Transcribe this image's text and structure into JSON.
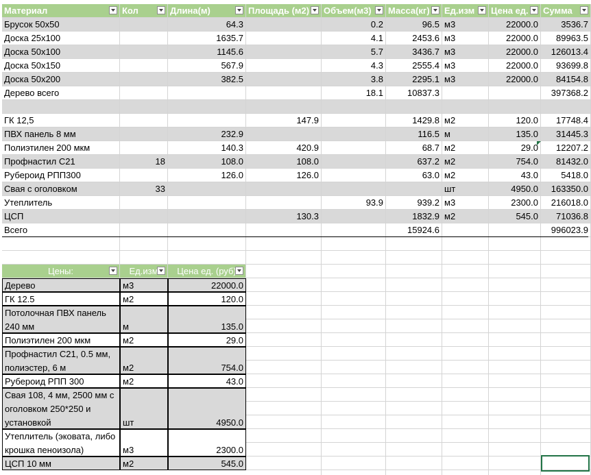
{
  "table1": {
    "headers": [
      "Материал",
      "Кол",
      "Длина(м)",
      "Площадь (м2)",
      "Объем(м3)",
      "Масса(кг)",
      "Ед.изм",
      "Цена ед.",
      "Сумма"
    ],
    "rows": [
      [
        "Брусок 50x50",
        "",
        "64.3",
        "",
        "0.2",
        "96.5",
        "м3",
        "22000.0",
        "3536.7"
      ],
      [
        "Доска 25x100",
        "",
        "1635.7",
        "",
        "4.1",
        "2453.6",
        "м3",
        "22000.0",
        "89963.5"
      ],
      [
        "Доска 50x100",
        "",
        "1145.6",
        "",
        "5.7",
        "3436.7",
        "м3",
        "22000.0",
        "126013.4"
      ],
      [
        "Доска 50x150",
        "",
        "567.9",
        "",
        "4.3",
        "2555.4",
        "м3",
        "22000.0",
        "93699.8"
      ],
      [
        "Доска 50x200",
        "",
        "382.5",
        "",
        "3.8",
        "2295.1",
        "м3",
        "22000.0",
        "84154.8"
      ],
      [
        "Дерево всего",
        "",
        "",
        "",
        "18.1",
        "10837.3",
        "",
        "",
        "397368.2"
      ],
      [
        "",
        "",
        "",
        "",
        "",
        "",
        "",
        "",
        ""
      ],
      [
        "ГК 12,5",
        "",
        "",
        "147.9",
        "",
        "1429.8",
        "м2",
        "120.0",
        "17748.4"
      ],
      [
        "ПВХ панель 8 мм",
        "",
        "232.9",
        "",
        "",
        "116.5",
        "м",
        "135.0",
        "31445.3"
      ],
      [
        "Полиэтилен 200 мкм",
        "",
        "140.3",
        "420.9",
        "",
        "68.7",
        "м2",
        "29.0",
        "12207.2"
      ],
      [
        "Профнастил С21",
        "18",
        "108.0",
        "108.0",
        "",
        "637.2",
        "м2",
        "754.0",
        "81432.0"
      ],
      [
        "Рубероид РПП300",
        "",
        "126.0",
        "126.0",
        "",
        "63.0",
        "м2",
        "43.0",
        "5418.0"
      ],
      [
        "Свая с оголовком",
        "33",
        "",
        "",
        "",
        "",
        "шт",
        "4950.0",
        "163350.0"
      ],
      [
        "Утеплитель",
        "",
        "",
        "",
        "93.9",
        "939.2",
        "м3",
        "2300.0",
        "216018.0"
      ],
      [
        "ЦСП",
        "",
        "",
        "130.3",
        "",
        "1832.9",
        "м2",
        "545.0",
        "71036.8"
      ],
      [
        "Всего",
        "",
        "",
        "",
        "",
        "15924.6",
        "",
        "",
        "996023.9"
      ]
    ]
  },
  "table2": {
    "headers": [
      "Цены:",
      "Ед.изм",
      "Цена ед. (руб)"
    ],
    "rows": [
      [
        "Дерево",
        "м3",
        "22000.0"
      ],
      [
        "ГК 12.5",
        "м2",
        "120.0"
      ],
      [
        "Потолочная ПВХ панель 240 мм",
        "м",
        "135.0"
      ],
      [
        "Полиэтилен 200 мкм",
        "м2",
        "29.0"
      ],
      [
        "Профнастил С21, 0.5 мм, полиэстер, 6 м",
        "м2",
        "754.0"
      ],
      [
        "Рубероид РПП 300",
        "м2",
        "43.0"
      ],
      [
        "Свая 108, 4 мм, 2500 мм с оголовком 250*250 и установкой",
        "шт",
        "4950.0"
      ],
      [
        "Утеплитель (эковата, либо крошка пеноизола)",
        "м3",
        "2300.0"
      ],
      [
        "ЦСП 10 мм",
        "м2",
        "545.0"
      ]
    ]
  },
  "colors": {
    "header_bg": "#a9d08e",
    "band_bg": "#d9d9d9",
    "grid": "#d4d4d4",
    "selection": "#217346"
  }
}
